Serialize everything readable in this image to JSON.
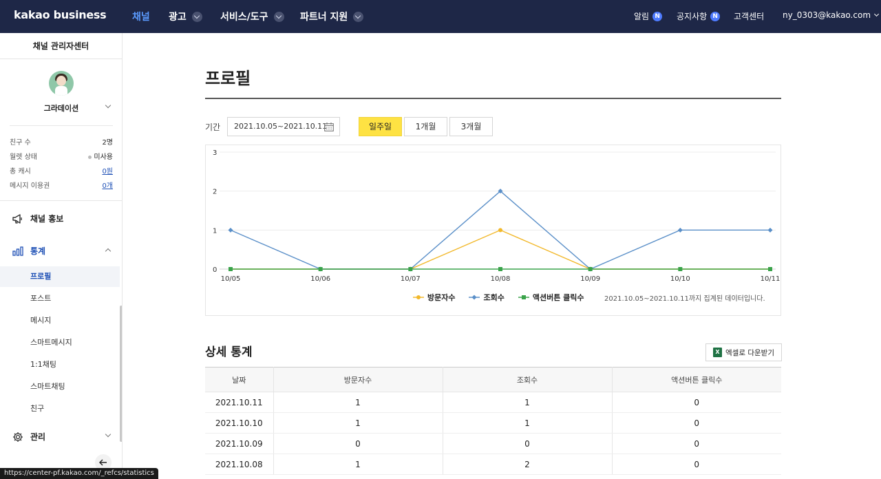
{
  "topbar": {
    "logo": "kakao business",
    "nav": [
      {
        "label": "채널",
        "active": true,
        "dropdown": false
      },
      {
        "label": "광고",
        "active": false,
        "dropdown": true
      },
      {
        "label": "서비스/도구",
        "active": false,
        "dropdown": true
      },
      {
        "label": "파트너 지원",
        "active": false,
        "dropdown": true
      }
    ],
    "alerts_label": "알림",
    "notice_label": "공지사항",
    "badge_new": "N",
    "support_label": "고객센터",
    "account_email": "ny_0303@kakao.com"
  },
  "sidebar": {
    "title": "채널 관리자센터",
    "profile_name": "그라데이션",
    "info": [
      {
        "label": "친구 수",
        "value": "2명"
      },
      {
        "label": "월렛 상태",
        "value": "미사용"
      },
      {
        "label": "총 캐시",
        "value": "0원"
      },
      {
        "label": "메시지 이용권",
        "value": "0개"
      }
    ],
    "menu_promo": "채널 홍보",
    "menu_stats": "통계",
    "stats_items": [
      "프로필",
      "포스트",
      "메시지",
      "스마트메시지",
      "1:1채팅",
      "스마트채팅",
      "친구"
    ],
    "menu_manage": "관리",
    "status_url": "https://center-pf.kakao.com/_refcs/statistics"
  },
  "main": {
    "page_title": "프로필",
    "period_label": "기간",
    "date_range": "2021.10.05~2021.10.11",
    "period_buttons": [
      "일주일",
      "1개월",
      "3개월"
    ],
    "chart_note": "2021.10.05~2021.10.11까지 집계된 데이터입니다.",
    "section_title": "상세 통계",
    "excel_label": "엑셀로 다운받기",
    "table": {
      "headers": [
        "날짜",
        "방문자수",
        "조회수",
        "액션버튼 클릭수"
      ],
      "rows": [
        [
          "2021.10.11",
          "1",
          "1",
          "0"
        ],
        [
          "2021.10.10",
          "1",
          "1",
          "0"
        ],
        [
          "2021.10.09",
          "0",
          "0",
          "0"
        ],
        [
          "2021.10.08",
          "1",
          "2",
          "0"
        ]
      ]
    }
  },
  "colors": {
    "visitors": "#f2b82a",
    "views": "#5a8fc8",
    "action_clicks": "#3aa34a",
    "topbar": "#1e2747",
    "active_menu": "#1d4fb5"
  },
  "chart_data": {
    "type": "line",
    "categories": [
      "10/05",
      "10/06",
      "10/07",
      "10/08",
      "10/09",
      "10/10",
      "10/11"
    ],
    "series": [
      {
        "name": "방문자수",
        "values": [
          0,
          0,
          0,
          1,
          0,
          0,
          0
        ]
      },
      {
        "name": "조회수",
        "values": [
          1,
          0,
          0,
          2,
          0,
          1,
          1
        ]
      },
      {
        "name": "액션버튼 클릭수",
        "values": [
          0,
          0,
          0,
          0,
          0,
          0,
          0
        ]
      }
    ],
    "yticks": [
      "0",
      "1",
      "2",
      "3"
    ],
    "ylim": [
      0,
      3
    ],
    "legend_position": "bottom"
  }
}
